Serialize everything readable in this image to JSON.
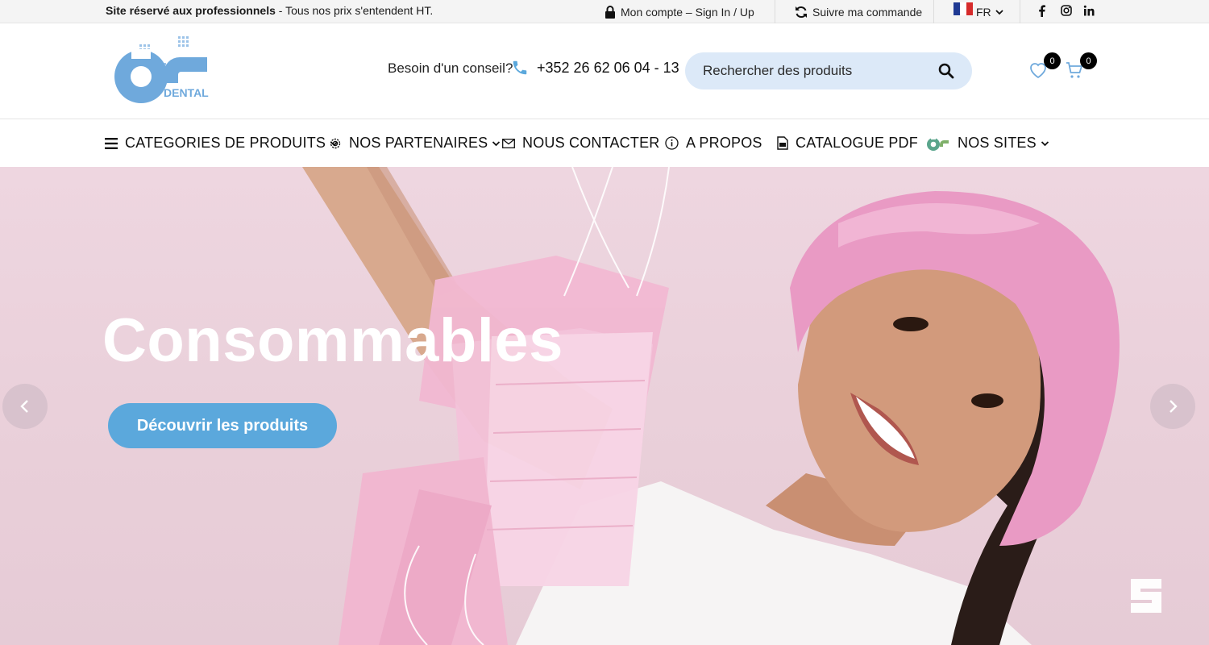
{
  "topbar": {
    "notice_bold": "Site réservé aux professionnels",
    "notice_rest": " - Tous nos prix s'entendent HT.",
    "account": "Mon compte – Sign In / Up",
    "track": "Suivre ma commande",
    "language": "FR",
    "social": [
      "facebook-icon",
      "instagram-icon",
      "linkedin-icon"
    ]
  },
  "header": {
    "logo_text": "DENTAL",
    "advice": "Besoin d'un conseil?",
    "phone": "+352 26 62 06 04 - 13",
    "search_placeholder": "Rechercher des produits",
    "wishlist_count": "0",
    "cart_count": "0"
  },
  "nav": {
    "items": [
      {
        "label": "CATEGORIES DE PRODUITS",
        "icon": "menu-icon"
      },
      {
        "label": "NOS PARTENAIRES",
        "icon": "settings-icon"
      },
      {
        "label": "NOUS CONTACTER",
        "icon": "envelope-icon"
      },
      {
        "label": "A PROPOS",
        "icon": "info-icon"
      },
      {
        "label": "CATALOGUE PDF",
        "icon": "pdf-icon"
      },
      {
        "label": "NOS SITES",
        "icon": "logo-mini-icon"
      }
    ]
  },
  "hero": {
    "title": "Consommables",
    "cta": "Découvrir les produits"
  },
  "colors": {
    "accent": "#5ba8dc",
    "search_bg": "#dce9f8",
    "hero_bg": "#eed6e0",
    "logo_blue": "#6fa9dc"
  }
}
